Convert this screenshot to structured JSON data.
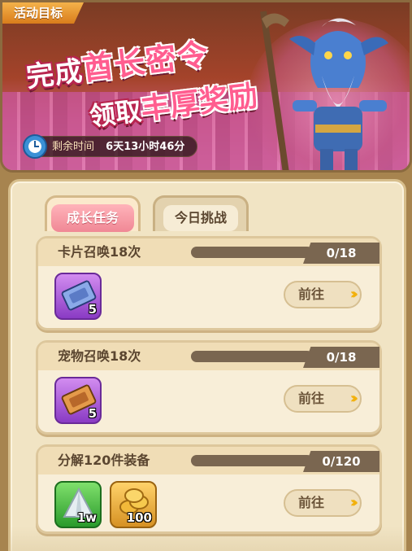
{
  "banner": {
    "tag": "活动目标",
    "title_line1_a": "完成",
    "title_line1_b": "酋长密令",
    "title_line2_a": "领取",
    "title_line2_b": "丰厚奖励",
    "timer_label": "剩余时间",
    "timer_value": "6天13小时46分"
  },
  "tabs": [
    {
      "label": "成长任务",
      "active": true
    },
    {
      "label": "今日挑战",
      "active": false
    }
  ],
  "tasks": [
    {
      "name": "卡片召唤18次",
      "progress": "0/18",
      "progress_fraction": 0,
      "button": "前往",
      "arrows": "›››",
      "rewards": [
        {
          "icon": "blue-card-ticket-icon",
          "count": "5"
        }
      ]
    },
    {
      "name": "宠物召唤18次",
      "progress": "0/18",
      "progress_fraction": 0,
      "button": "前往",
      "arrows": "›››",
      "rewards": [
        {
          "icon": "orange-pet-ticket-icon",
          "count": "5"
        }
      ]
    },
    {
      "name": "分解120件装备",
      "progress": "0/120",
      "progress_fraction": 0,
      "button": "前往",
      "arrows": "›››",
      "rewards": [
        {
          "icon": "silver-crystal-icon",
          "count": "1w"
        },
        {
          "icon": "gold-coins-icon",
          "count": "100"
        }
      ]
    }
  ],
  "colors": {
    "accent_pink": "#f08895",
    "progress_bar": "#7a6650",
    "arrow_yellow": "#f2b10d"
  }
}
